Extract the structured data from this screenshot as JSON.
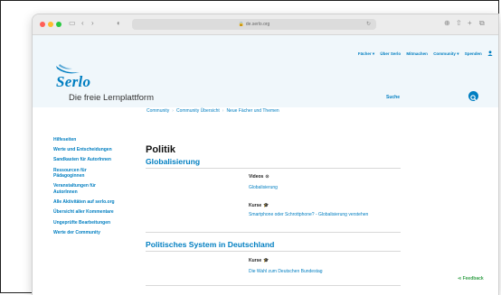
{
  "browser": {
    "url": "de.serlo.org"
  },
  "header": {
    "nav": [
      "Fächer ▾",
      "Über Serlo",
      "Mitmachen",
      "Community ▾",
      "Spenden"
    ],
    "logo_text": "Serlo",
    "tagline": "Die freie Lernplattform",
    "search_label": "Suche"
  },
  "breadcrumb": [
    "Community",
    "Community Übersicht",
    "Neue Fächer und Themen"
  ],
  "sidebar": {
    "items": [
      "Hilfeseiten",
      "Werte und Entscheidungen",
      "Sandkasten für AutorInnen",
      "Ressourcen für Pädagoginnen",
      "Veranstaltungen für AutorInnen",
      "Alle Aktivitäten auf serlo.org",
      "Übersicht aller Kommentare",
      "Ungeprüfte Bearbeitungen",
      "Werte der Community"
    ]
  },
  "main": {
    "title": "Politik",
    "sections": [
      {
        "heading": "Globalisierung",
        "blocks": [
          {
            "label": "Videos",
            "links": [
              "Globalisierung"
            ]
          },
          {
            "label": "Kurse",
            "links": [
              "Smartphone oder Schrottphone? - Globalisierung verstehen"
            ]
          }
        ]
      },
      {
        "heading": "Politisches System in Deutschland",
        "blocks": [
          {
            "label": "Kurse",
            "links": [
              "Die Wahl zum Deutschen Bundestag"
            ]
          }
        ]
      }
    ]
  },
  "feedback_label": "Feedback"
}
